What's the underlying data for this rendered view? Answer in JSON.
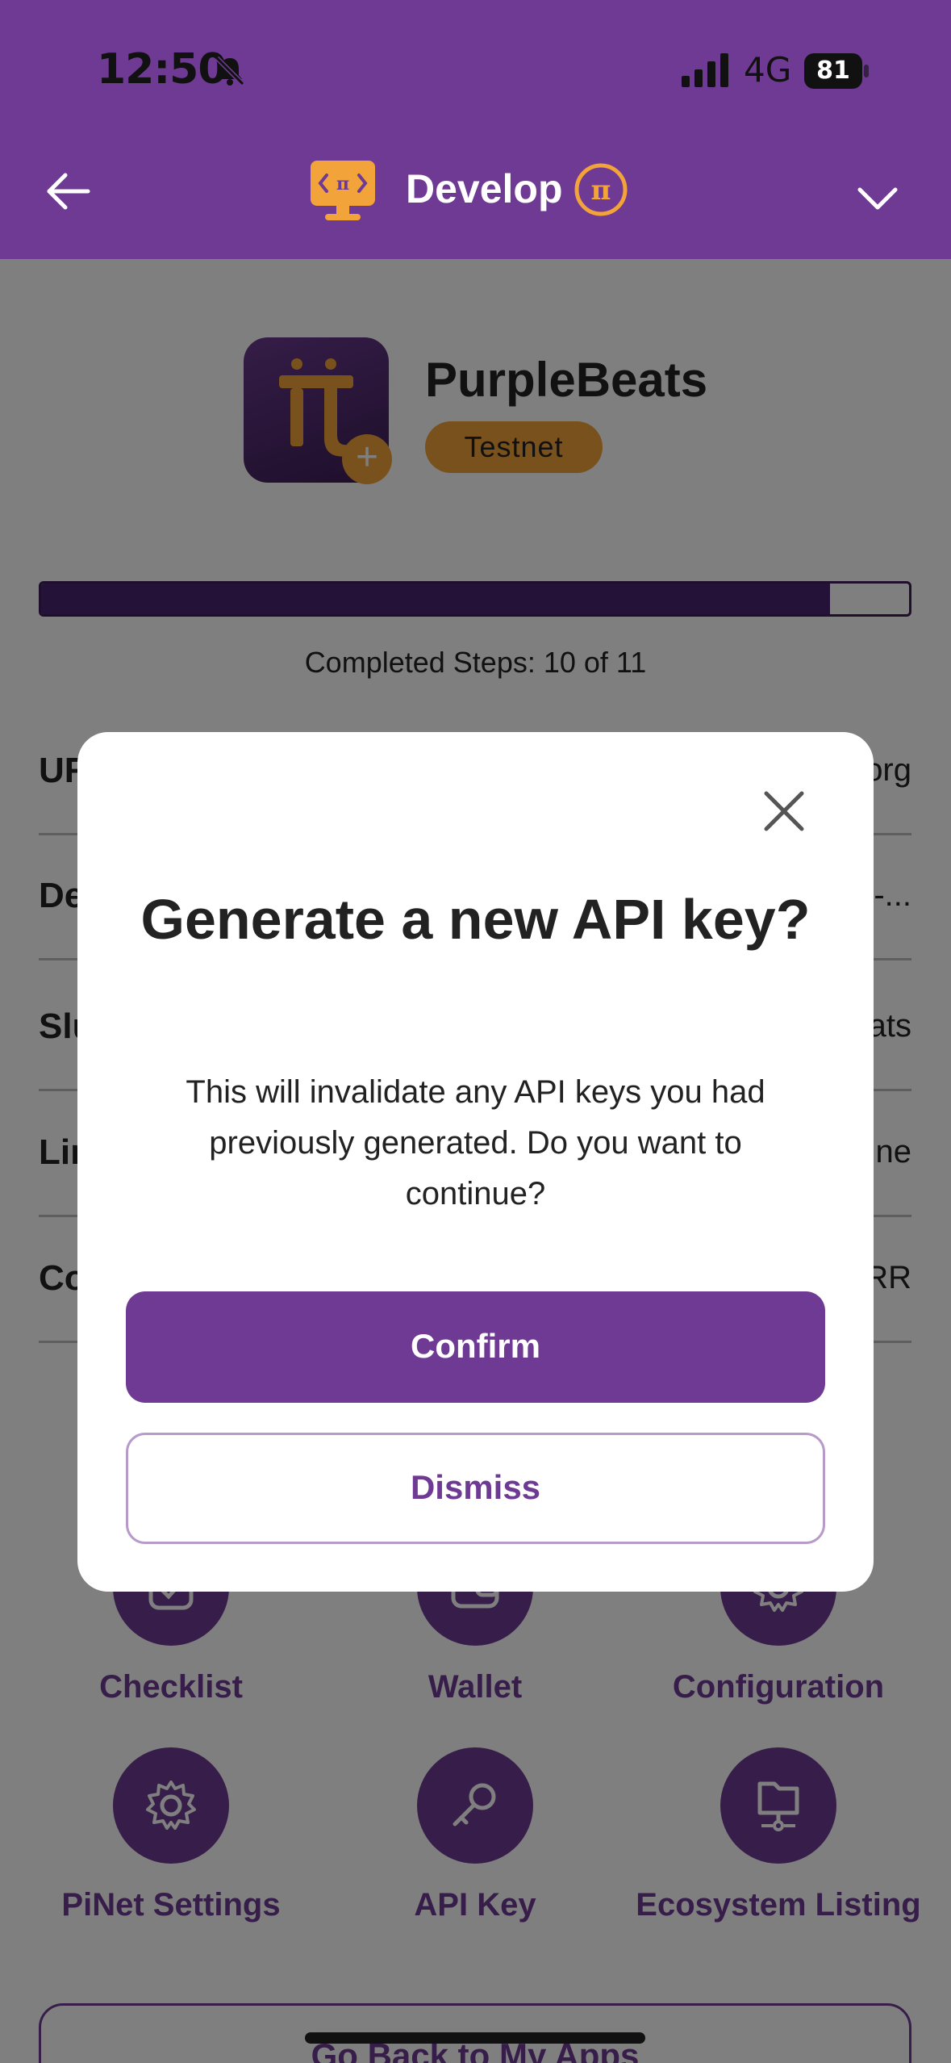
{
  "status_bar": {
    "time": "12:50",
    "network": "4G",
    "battery": "81"
  },
  "nav": {
    "title": "Develop"
  },
  "app": {
    "name": "PurpleBeats",
    "badge": "Testnet"
  },
  "progress": {
    "label": "Completed Steps: 10 of 11",
    "completed": 10,
    "total": 11
  },
  "info_rows": [
    {
      "label": "UR",
      "value": "org"
    },
    {
      "label": "De",
      "value": "-..."
    },
    {
      "label": "Slu",
      "value": "ats"
    },
    {
      "label": "Lin",
      "value": "ne"
    },
    {
      "label": "Co",
      "value": "RR"
    }
  ],
  "features": [
    {
      "label": "Checklist",
      "icon": "checklist-icon"
    },
    {
      "label": "Wallet",
      "icon": "wallet-icon"
    },
    {
      "label": "Configuration",
      "icon": "gear-icon"
    },
    {
      "label": "PiNet Settings",
      "icon": "gear-icon"
    },
    {
      "label": "API Key",
      "icon": "key-icon"
    },
    {
      "label": "Ecosystem Listing",
      "icon": "network-folder-icon"
    }
  ],
  "go_back_label": "Go Back to My Apps",
  "dialog": {
    "title": "Generate a new API key?",
    "body": "This will invalidate any API keys you had previously generated. Do you want to continue?",
    "confirm_label": "Confirm",
    "dismiss_label": "Dismiss"
  },
  "colors": {
    "brand_purple": "#6f3a93",
    "accent_orange": "#f2a33a"
  }
}
